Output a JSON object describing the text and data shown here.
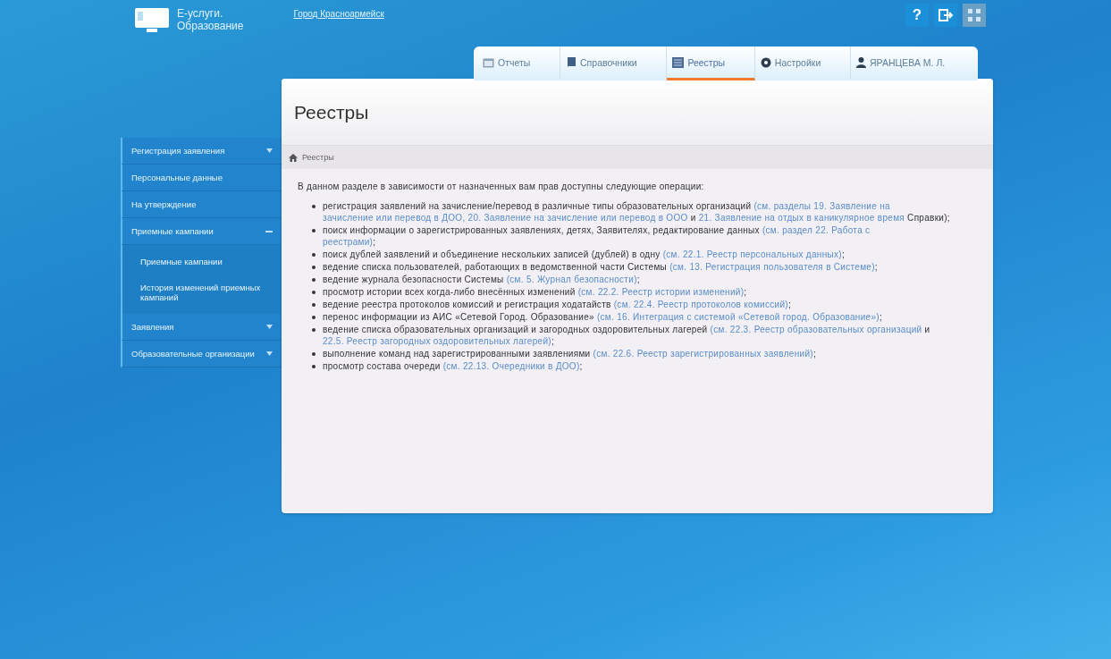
{
  "header": {
    "logo_text": "Е-услуги.",
    "logo_subtext": "Образование",
    "region_link": "Город Красноармейск",
    "icon_buttons": [
      {
        "kind": "help",
        "label": "?",
        "disabled": false
      },
      {
        "kind": "exit",
        "disabled": false
      },
      {
        "kind": "grid",
        "disabled": true
      }
    ]
  },
  "tabs": [
    {
      "kind": "calendar",
      "label": "Отчеты",
      "selected": false
    },
    {
      "kind": "book",
      "label": "Справочники",
      "selected": false
    },
    {
      "kind": "list",
      "label": "Реестры",
      "selected": true
    },
    {
      "kind": "gear",
      "label": "Настройки",
      "selected": false
    },
    {
      "kind": "user",
      "label": "ЯРАНЦЕВА М. Л.",
      "selected": false
    }
  ],
  "sidebar": {
    "items": [
      {
        "kind": "group",
        "label": "Регистрация заявления",
        "expanded": false
      },
      {
        "kind": "link",
        "label": "Персональные данные"
      },
      {
        "kind": "link",
        "label": "На утверждение"
      },
      {
        "kind": "group",
        "label": "Приемные кампании",
        "expanded": true,
        "children": [
          {
            "label": "Приемные кампании"
          },
          {
            "label": "История изменений приемных кампаний"
          }
        ]
      },
      {
        "kind": "group",
        "label": "Заявления",
        "expanded": false
      },
      {
        "kind": "group",
        "label": "Образовательные организации",
        "expanded": false
      }
    ]
  },
  "page": {
    "title": "Реестры",
    "breadcrumb": "Реестры",
    "intro": "В данном разделе в зависимости от назначенных вам прав доступны следующие операции:",
    "bullets": [
      [
        {
          "kind": "text",
          "text": "регистрация заявлений на зачисление/перевод в различные типы образовательных организаций "
        },
        {
          "kind": "link",
          "text": "(см. разделы 19. Заявление на",
          "line_end": true
        },
        {
          "kind": "link",
          "text": "зачисление или перевод в ДОО, 20. Заявление на зачисление или перевод в ООО"
        },
        {
          "kind": "text",
          "text": " и "
        },
        {
          "kind": "link",
          "text": "21. Заявление на отдых в каникулярное время"
        },
        {
          "kind": "text",
          "text": " Справки);"
        }
      ],
      [
        {
          "kind": "text",
          "text": "поиск информации о зарегистрированных заявлениях, детях, Заявителях, редактирование данных "
        },
        {
          "kind": "link",
          "text": "(см. раздел 22. Работа с",
          "line_end": true
        },
        {
          "kind": "link",
          "text": "реестрами)"
        },
        {
          "kind": "text",
          "text": ";"
        }
      ],
      [
        {
          "kind": "text",
          "text": "поиск дублей заявлений и объединение нескольких записей (дублей) в одну "
        },
        {
          "kind": "link",
          "text": "(см. 22.1. Реестр персональных данных)"
        },
        {
          "kind": "text",
          "text": ";"
        }
      ],
      [
        {
          "kind": "text",
          "text": "ведение списка пользователей, работающих в ведомственной части Системы "
        },
        {
          "kind": "link",
          "text": "(см. 13. Регистрация пользователя в Системе)"
        },
        {
          "kind": "text",
          "text": ";"
        }
      ],
      [
        {
          "kind": "text",
          "text": "ведение журнала безопасности Системы "
        },
        {
          "kind": "link",
          "text": "(см. 5. Журнал безопасности)"
        },
        {
          "kind": "text",
          "text": ";"
        }
      ],
      [
        {
          "kind": "text",
          "text": "просмотр истории всех когда-либо внесённых изменений "
        },
        {
          "kind": "link",
          "text": "(см. 22.2. Реестр истории изменений)"
        },
        {
          "kind": "text",
          "text": ";"
        }
      ],
      [
        {
          "kind": "text",
          "text": "ведение реестра протоколов комиссий и регистрация ходатайств "
        },
        {
          "kind": "link",
          "text": "(см. 22.4. Реестр протоколов комиссий)"
        },
        {
          "kind": "text",
          "text": ";"
        }
      ],
      [
        {
          "kind": "text",
          "text": "перенос информации из АИС «Сетевой Город. Образование» "
        },
        {
          "kind": "link",
          "text": "(см. 16. Интеграция с системой «Сетевой город. Образование»)"
        },
        {
          "kind": "text",
          "text": ";"
        }
      ],
      [
        {
          "kind": "text",
          "text": "ведение списка образовательных организаций и загородных оздоровительных лагерей "
        },
        {
          "kind": "link",
          "text": "(см. 22.3. Реестр образовательных организаций"
        },
        {
          "kind": "text",
          "text": " и "
        },
        {
          "kind": "link",
          "text": "22.5. Реестр загородных оздоровительных лагерей)"
        },
        {
          "kind": "text",
          "text": ";"
        }
      ],
      [
        {
          "kind": "text",
          "text": "выполнение команд над зарегистрированными заявлениями "
        },
        {
          "kind": "link",
          "text": "(см. 22.6. Реестр зарегистрированных заявлений)"
        },
        {
          "kind": "text",
          "text": ";"
        }
      ],
      [
        {
          "kind": "text",
          "text": "просмотр состава очереди "
        },
        {
          "kind": "link",
          "text": "(см. 22.13. Очередники в ДОО)"
        },
        {
          "kind": "text",
          "text": ";"
        }
      ]
    ]
  }
}
